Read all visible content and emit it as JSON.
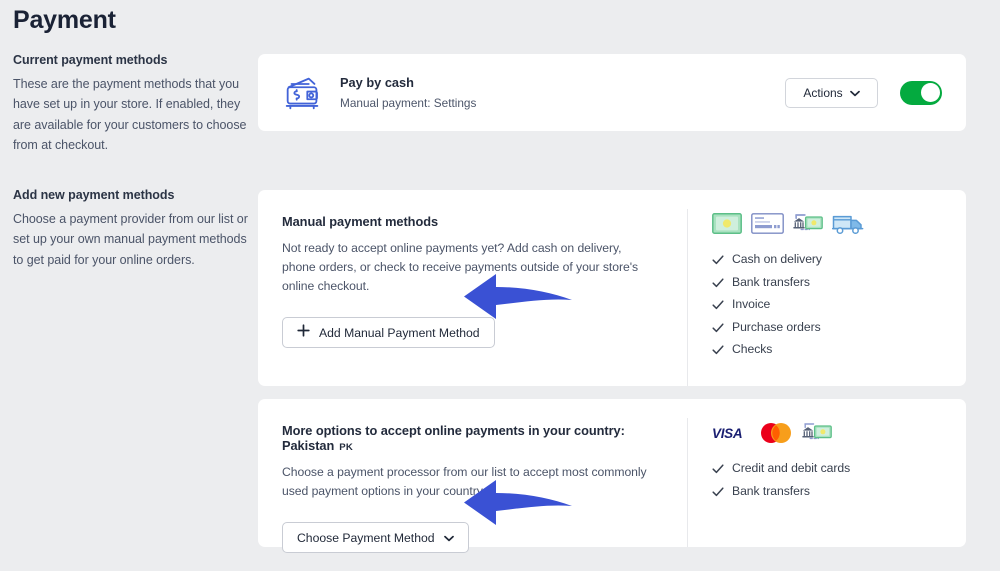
{
  "page": {
    "title": "Payment",
    "background_color": "#ECEDEF"
  },
  "sections": {
    "current": {
      "heading": "Current payment methods",
      "description": "These are the payment methods that you have set up in your store. If enabled, they are available for your customers to choose from at checkout."
    },
    "add_new": {
      "heading": "Add new payment methods",
      "description": "Choose a payment provider from our list or set up your own manual payment methods to get paid for your online orders."
    }
  },
  "current_method_card": {
    "icon": "wallet-icon",
    "title": "Pay by cash",
    "subtitle": "Manual payment: Settings",
    "actions_button": {
      "label": "Actions",
      "icon": "chevron-down-icon"
    },
    "toggle": {
      "enabled": true,
      "color": "#04AA3F"
    }
  },
  "manual_card": {
    "title": "Manual payment methods",
    "description": "Not ready to accept online payments yet? Add cash on delivery, phone orders, or check to receive payments outside of your store's online checkout.",
    "button": {
      "label": "Add Manual Payment Method",
      "icon": "plus-icon"
    },
    "logos": [
      "cash-banknote-icon",
      "check-icon",
      "bank-transfer-icon",
      "delivery-truck-icon"
    ],
    "features": [
      "Cash on delivery",
      "Bank transfers",
      "Invoice",
      "Purchase orders",
      "Checks"
    ]
  },
  "more_options_card": {
    "title": "More options to accept online payments in your country: Pakistan",
    "country_code": "PK",
    "description": "Choose a payment processor from our list to accept most commonly used payment options in your country.",
    "button": {
      "label": "Choose Payment Method",
      "icon": "chevron-down-icon"
    },
    "logos": [
      "visa-logo",
      "mastercard-logo",
      "bank-transfer-icon"
    ],
    "features": [
      "Credit and debit cards",
      "Bank transfers"
    ]
  },
  "annotations": {
    "arrow_color": "#3A51D4",
    "arrows": [
      {
        "name": "arrow-to-add-manual-payment-method"
      },
      {
        "name": "arrow-to-choose-payment-method"
      }
    ]
  }
}
